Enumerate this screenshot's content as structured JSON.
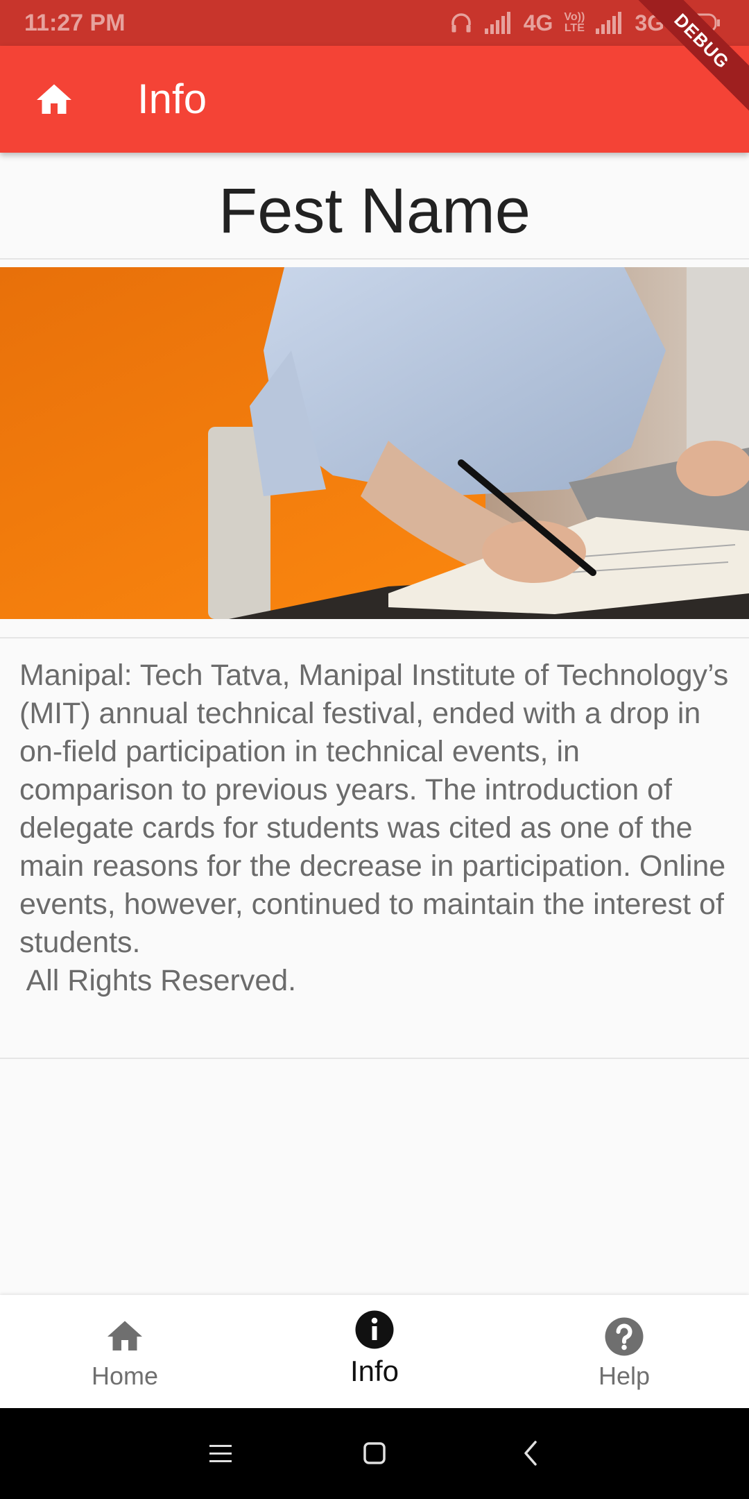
{
  "status_bar": {
    "time": "11:27 PM",
    "network_1": "4G",
    "volte_top": "Vo))",
    "volte_bottom": "LTE",
    "network_2": "3G",
    "icons": [
      "headphones-icon",
      "signal-icon",
      "signal-icon",
      "battery-icon"
    ]
  },
  "app_bar": {
    "title": "Info",
    "home_icon": "home-icon",
    "debug_label": "DEBUG"
  },
  "content": {
    "fest_name": "Fest Name",
    "image": "person writing in notebook beside laptop",
    "description": "Manipal: Tech Tatva, Manipal Institute of Technology’s (MIT) annual technical festival, ended with a drop in on-field participation in technical events, in comparison to previous years. The introduction of delegate cards for students was cited as one of the main reasons for the decrease in participation. Online events, however, continued to maintain the interest of students.",
    "rights": " All Rights Reserved."
  },
  "bottom_nav": {
    "items": [
      {
        "label": "Home",
        "icon": "home-icon",
        "active": false
      },
      {
        "label": "Info",
        "icon": "info-icon",
        "active": true
      },
      {
        "label": "Help",
        "icon": "help-icon",
        "active": false
      }
    ]
  },
  "colors": {
    "primary": "#f44336",
    "status_bar": "#c8352c",
    "nav_active": "#111111",
    "nav_inactive": "#6f6f6f"
  }
}
